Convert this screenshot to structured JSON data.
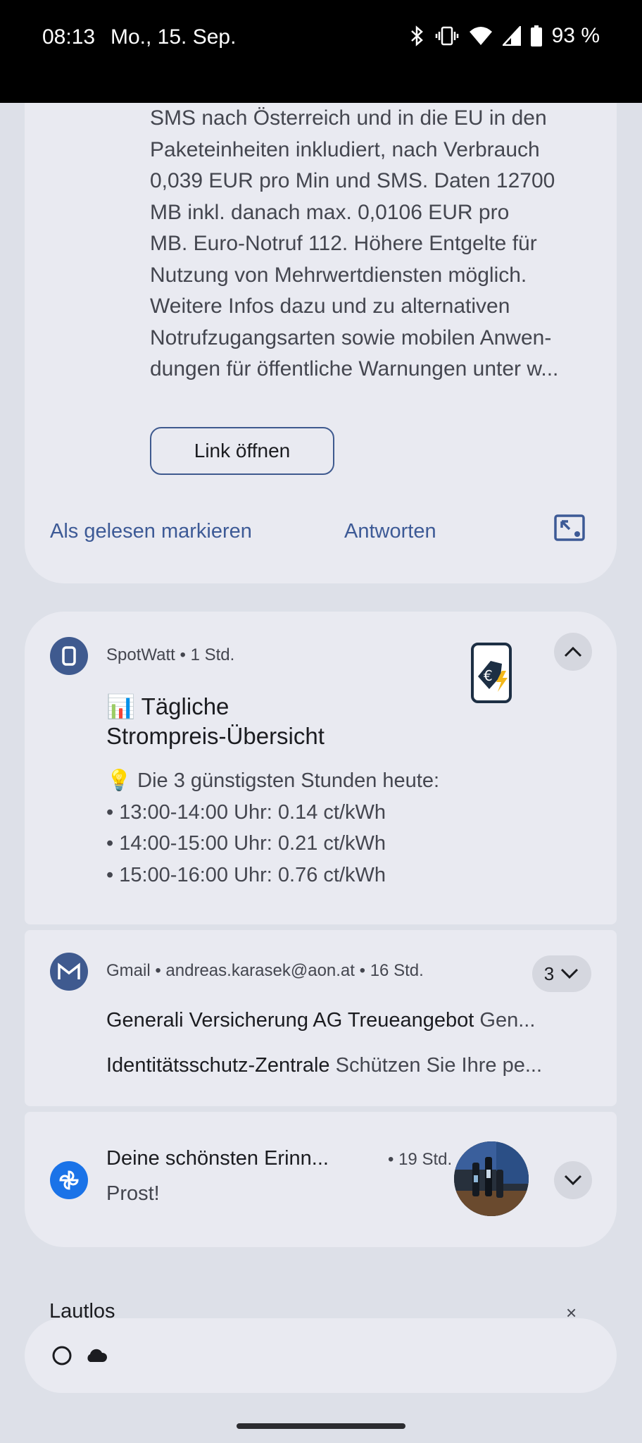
{
  "status_bar": {
    "time": "08:13",
    "date": "Mo., 15. Sep.",
    "battery": "93 %",
    "icons": [
      "bluetooth-icon",
      "vibrate-icon",
      "wifi-icon",
      "signal-icon",
      "battery-icon"
    ]
  },
  "sms_notification": {
    "body": "SMS nach Österreich und in die EU in den\nPaketeinheiten inkludiert, nach Verbrauch\n0,039 EUR pro Min und SMS. Daten 12700\nMB inkl. danach max. 0,0106 EUR pro\nMB. Euro-Notruf 112. Höhere Entgelte für\nNutzung von Mehrwertdiensten möglich.\nWeitere Infos dazu und zu alternativen\nNotrufzugangsarten sowie mobilen Anwen-\ndungen für öffentliche Warnungen unter w...",
    "link_button": "Link öffnen",
    "action_mark_read": "Als gelesen markieren",
    "action_reply": "Antworten"
  },
  "spotwatt_notification": {
    "app_name": "SpotWatt",
    "time": "1 Std.",
    "title_line1": "📊 Tägliche",
    "title_line2": "Strompreis-Übersicht",
    "body_lines": [
      "💡 Die 3 günstigsten Stunden heute:",
      "• 13:00-14:00 Uhr: 0.14 ct/kWh",
      "• 14:00-15:00 Uhr: 0.21 ct/kWh",
      "• 15:00-16:00 Uhr: 0.76 ct/kWh"
    ]
  },
  "gmail_notification": {
    "app_name": "Gmail",
    "account": "andreas.karasek@aon.at",
    "time": "16 Std.",
    "count": "3",
    "messages": [
      {
        "sender": "Generali Versicherung AG Treueangebot",
        "snippet": "Gen..."
      },
      {
        "sender": "Identitätsschutz-Zentrale",
        "snippet": "Schützen Sie Ihre pe..."
      }
    ]
  },
  "photos_notification": {
    "title": "Deine schönsten Erinn...",
    "time": "19 Std.",
    "body": "Prost!"
  },
  "silent_section": {
    "label": "Lautlos",
    "clear": "×"
  },
  "colors": {
    "accent": "#3d5a96",
    "background": "#dde0e8",
    "card": "#e9eaf1"
  }
}
